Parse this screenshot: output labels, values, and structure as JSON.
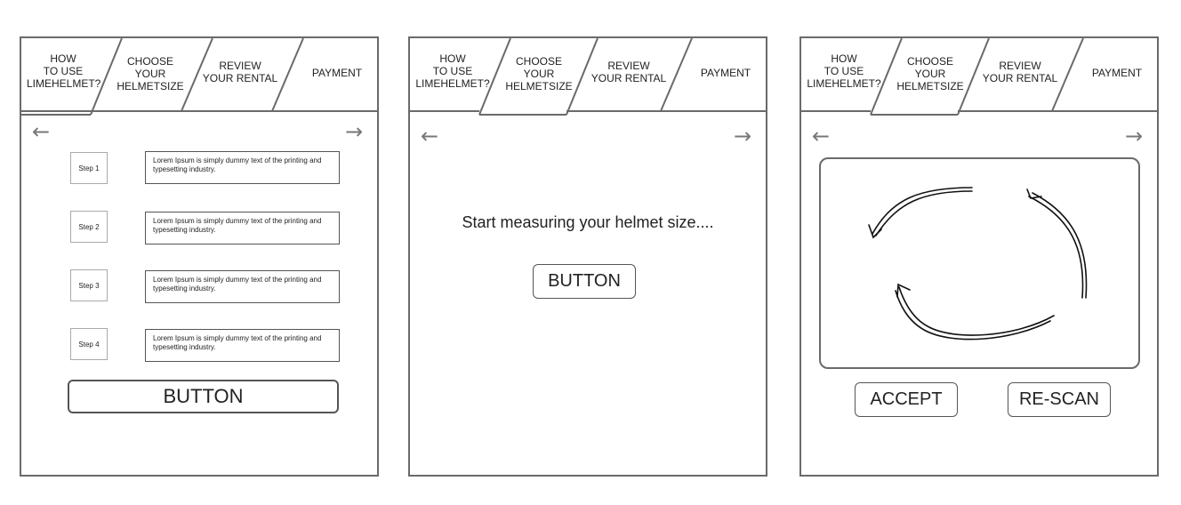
{
  "tabs": [
    {
      "label": "HOW\nTO USE\nLIMEHELMET?"
    },
    {
      "label": "CHOOSE\nYOUR\nHELMETSIZE"
    },
    {
      "label": "REVIEW\nYOUR RENTAL"
    },
    {
      "label": "PAYMENT"
    }
  ],
  "nav": {
    "back_icon": "arrow-left-icon",
    "forward_icon": "arrow-right-icon"
  },
  "screen1": {
    "steps": [
      {
        "label": "Step 1",
        "text": "Lorem Ipsum is simply dummy text of the printing and typesetting industry."
      },
      {
        "label": "Step 2",
        "text": "Lorem Ipsum is simply dummy text of the printing and typesetting industry."
      },
      {
        "label": "Step 3",
        "text": "Lorem Ipsum is simply dummy text of the printing and typesetting industry."
      },
      {
        "label": "Step 4",
        "text": "Lorem Ipsum is simply dummy text of the printing and typesetting industry."
      }
    ],
    "button_label": "BUTTON"
  },
  "screen2": {
    "prompt": "Start measuring your helmet size....",
    "button_label": "BUTTON"
  },
  "screen3": {
    "scan_icon": "rotate-scan-arrows-icon",
    "accept_label": "ACCEPT",
    "rescan_label": "RE-SCAN"
  }
}
